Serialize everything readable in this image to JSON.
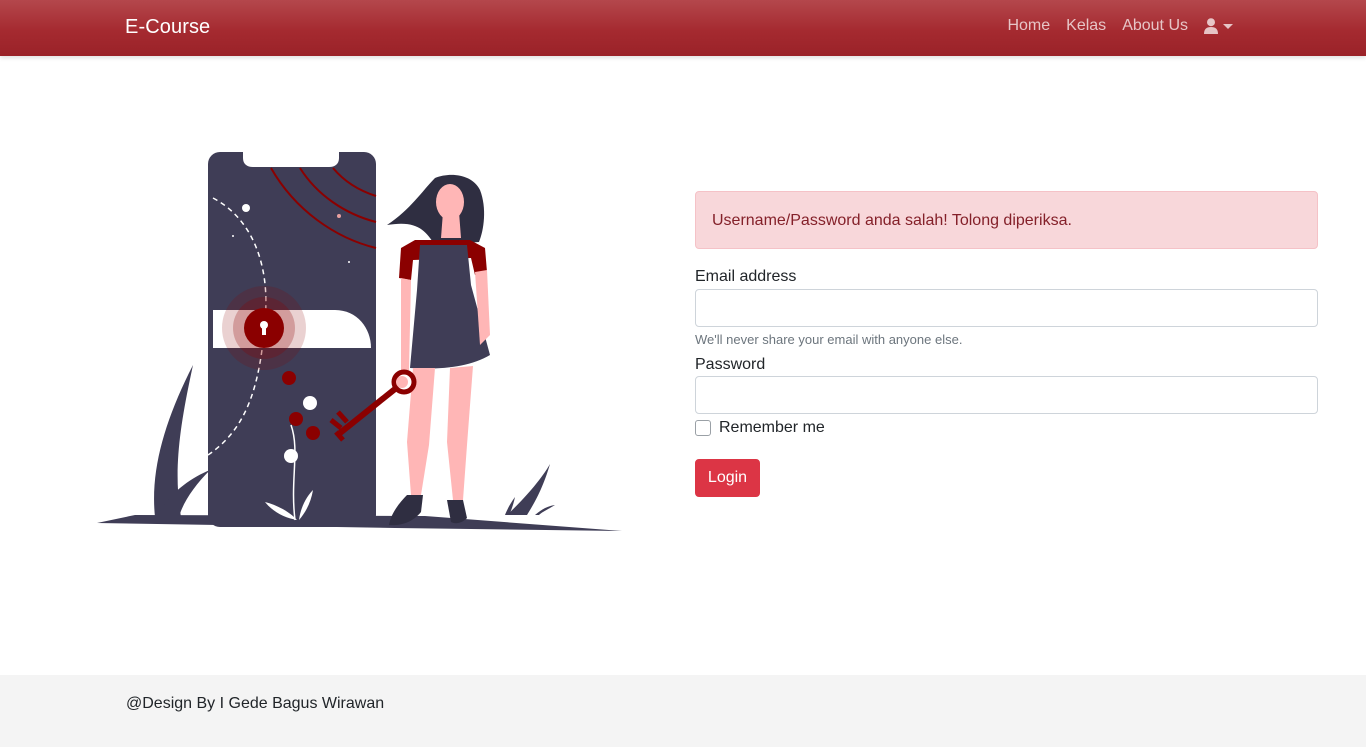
{
  "navbar": {
    "brand": "E-Course",
    "links": [
      "Home",
      "Kelas",
      "About Us"
    ],
    "user_icon": "user-icon",
    "caret_icon": "caret-down-icon",
    "bg_color": "#a52a30"
  },
  "illustration": {
    "accent_color": "#8b0000",
    "dark_color": "#3f3d56",
    "skin_color": "#ffb6b6"
  },
  "alert": {
    "message": "Username/Password anda salah! Tolong diperiksa.",
    "bg_color": "#f8d7da",
    "text_color": "#842029"
  },
  "form": {
    "email_label": "Email address",
    "email_value": "",
    "email_help": "We'll never share your email with anyone else.",
    "password_label": "Password",
    "password_value": "",
    "remember_label": "Remember me",
    "remember_checked": false,
    "login_button": "Login",
    "button_color": "#dc3545"
  },
  "footer": {
    "text": "@Design By I Gede Bagus Wirawan"
  }
}
